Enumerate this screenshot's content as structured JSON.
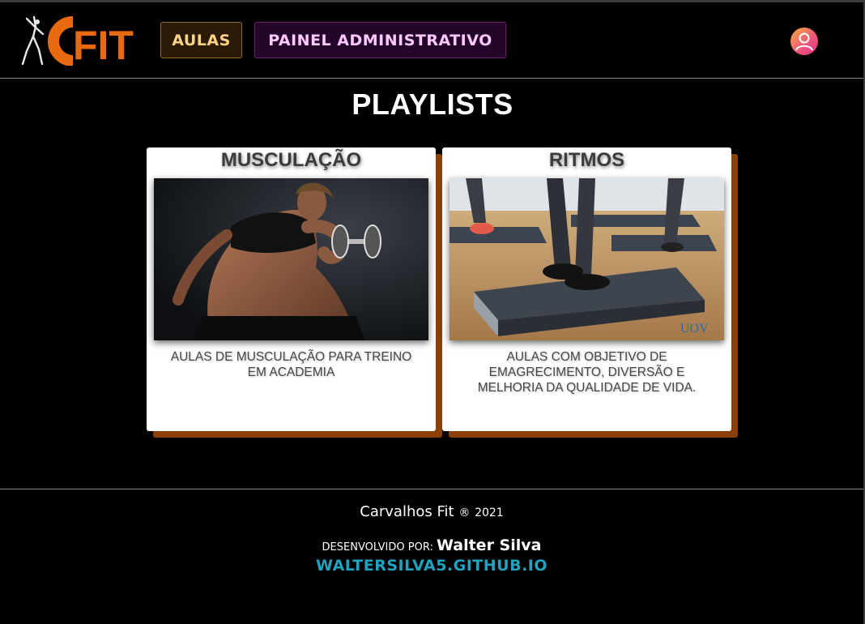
{
  "header": {
    "logo_text": "CFIT",
    "nav": [
      {
        "label": "AULAS"
      },
      {
        "label": "PAINEL ADMINISTRATIVO"
      }
    ],
    "avatar_icon": "user-avatar-icon"
  },
  "main": {
    "title": "PLAYLISTS",
    "playlists": [
      {
        "title": "MUSCULAÇÃO",
        "description": "AULAS DE MUSCULAÇÃO PARA TREINO EM ACADEMIA"
      },
      {
        "title": "RITMOS",
        "description": "AULAS COM OBJETIVO DE EMAGRECIMENTO, DIVERSÃO E MELHORIA DA QUALIDADE DE VIDA.",
        "image_watermark": "UOV"
      }
    ]
  },
  "footer": {
    "brand": "Carvalhos Fit",
    "registered": "®",
    "year": "2021",
    "developed_by_label": "DESENVOLVIDO POR:",
    "developer_name": "Walter Silva",
    "developer_site": "WALTERSILVA5.GITHUB.IO"
  },
  "colors": {
    "background": "#000000",
    "logo_orange": "#e8690f",
    "card_shadow": "#8a4007",
    "link": "#1ea3c0"
  }
}
